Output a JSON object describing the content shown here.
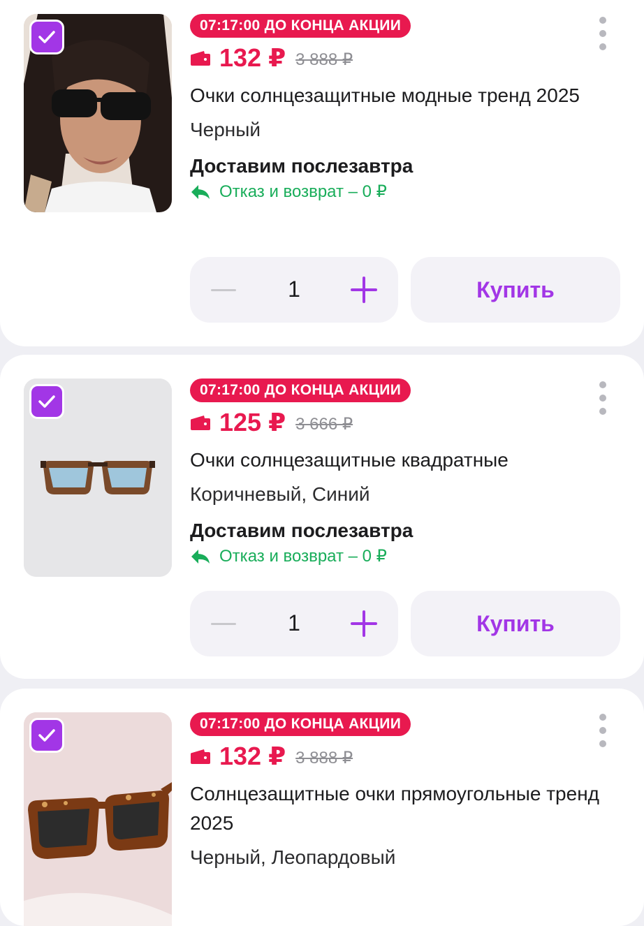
{
  "products": [
    {
      "timer": "07:17:00 ДО КОНЦА АКЦИИ",
      "price": "132 ₽",
      "old_price": "3 888 ₽",
      "title": "Очки солнцезащитные модные тренд 2025",
      "color": "Черный",
      "delivery": "Доставим послезавтра",
      "returns": "Отказ и возврат – 0 ₽",
      "quantity": "1",
      "buy_label": "Купить",
      "checked": true
    },
    {
      "timer": "07:17:00 ДО КОНЦА АКЦИИ",
      "price": "125 ₽",
      "old_price": "3 666 ₽",
      "title": "Очки солнцезащитные квадратные",
      "color": "Коричневый, Синий",
      "delivery": "Доставим послезавтра",
      "returns": "Отказ и возврат – 0 ₽",
      "quantity": "1",
      "buy_label": "Купить",
      "checked": true
    },
    {
      "timer": "07:17:00 ДО КОНЦА АКЦИИ",
      "price": "132 ₽",
      "old_price": "3 888 ₽",
      "title": "Солнцезащитные очки прямоугольные тренд 2025",
      "color": "Черный, Леопардовый",
      "checked": true
    }
  ],
  "colors": {
    "accent": "#a236e6",
    "sale": "#e8194f",
    "returns": "#19ad5a"
  }
}
